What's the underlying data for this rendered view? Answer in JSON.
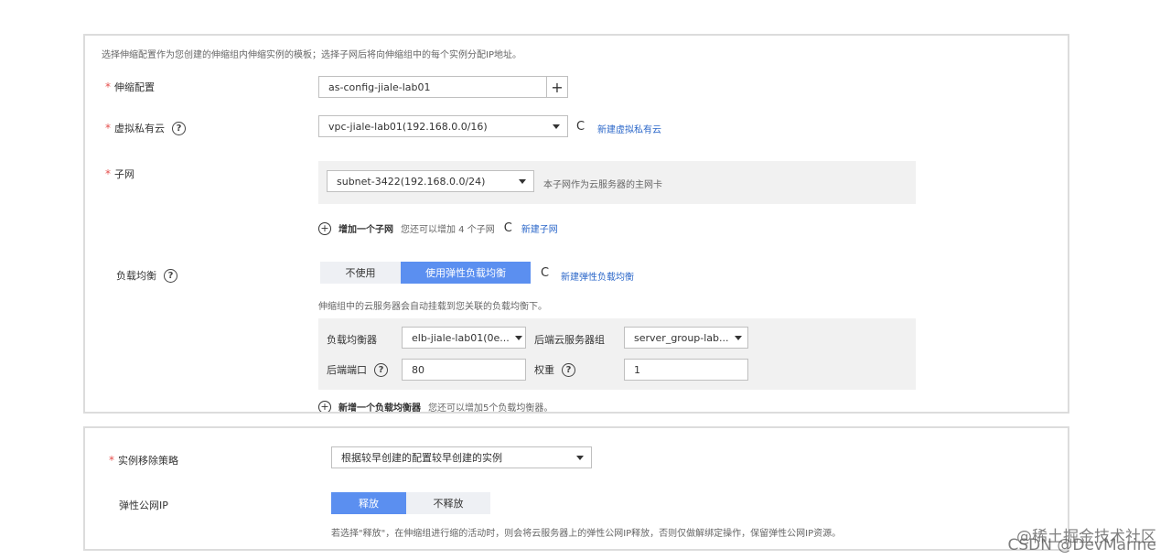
{
  "panel1": {
    "description": "选择伸缩配置作为您创建的伸缩组内伸缩实例的模板；选择子网后将向伸缩组中的每个实例分配IP地址。",
    "as_config": {
      "label": "伸缩配置",
      "value": "as-config-jiale-lab01",
      "plus": "+"
    },
    "vpc": {
      "label": "虚拟私有云",
      "value": "vpc-jiale-lab01(192.168.0.0/16)",
      "link": "新建虚拟私有云"
    },
    "subnet": {
      "label": "子网",
      "value": "subnet-3422(192.168.0.0/24)",
      "hint": "本子网作为云服务器的主网卡",
      "add_label": "增加一个子网",
      "add_hint": "您还可以增加 4 个子网",
      "new_link": "新建子网"
    },
    "lb": {
      "label": "负载均衡",
      "toggle_off": "不使用",
      "toggle_on": "使用弹性负载均衡",
      "new_link": "新建弹性负载均衡",
      "hint": "伸缩组中的云服务器会自动挂载到您关联的负载均衡下。",
      "balancer_label": "负载均衡器",
      "balancer_value": "elb-jiale-lab01(0e...",
      "group_label": "后端云服务器组",
      "group_value": "server_group-lab...",
      "port_label": "后端端口",
      "port_value": "80",
      "weight_label": "权重",
      "weight_value": "1",
      "add_label": "新增一个负载均衡器",
      "add_hint": "您还可以增加5个负载均衡器。"
    }
  },
  "panel2": {
    "removal": {
      "label": "实例移除策略",
      "value": "根据较早创建的配置较早创建的实例"
    },
    "eip": {
      "label": "弹性公网IP",
      "toggle_on": "释放",
      "toggle_off": "不释放",
      "hint": "若选择\"释放\"，在伸缩组进行缩的活动时，则会将云服务器上的弹性公网IP释放，否则仅做解绑定操作，保留弹性公网IP资源。"
    }
  },
  "watermark": {
    "line1": "@稀土掘金技术社区",
    "line2": "CSDN @DevMarine"
  },
  "icons": {
    "question": "?",
    "refresh": "C",
    "required": "*"
  },
  "colors": {
    "accent": "#5b8ff0",
    "link": "#2b67c9",
    "required": "#e5504d"
  }
}
